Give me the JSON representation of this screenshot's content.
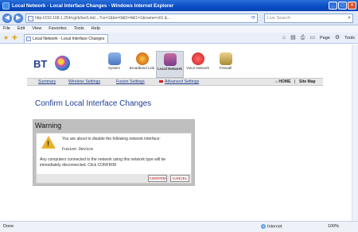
{
  "window": {
    "title": "Local Network - Local Interface Changes - Windows Internet Explorer",
    "controls": [
      "_",
      "□",
      "×"
    ]
  },
  "browser": {
    "address": "http://192.168.1.254/cgi/b/lan/Link/...?ce=1&be=0&l0=4&l1=1&name=ctl1 &...",
    "search_placeholder": "Live Search",
    "menu": [
      "File",
      "Edit",
      "View",
      "Favorites",
      "Tools",
      "Help"
    ],
    "tab_title": "Local Network - Local Interface Changes",
    "commands": {
      "page": "Page",
      "tools": "Tools"
    }
  },
  "page": {
    "logo_text": "BT",
    "nav_icons": [
      {
        "label": "System"
      },
      {
        "label": "Broadband Link"
      },
      {
        "label": "Local Network"
      },
      {
        "label": "Voice Network"
      },
      {
        "label": "Firewall"
      }
    ],
    "tabs": [
      "Summary",
      "Wireless Settings",
      "Fusion Settings",
      "Advanced Settings"
    ],
    "home_label": "HOME",
    "sitemap_label": "Site Map",
    "heading": "Confirm Local Interface Changes",
    "warning": {
      "title": "Warning",
      "message": "You are about to disable the following network interface:",
      "interface": "Fusion Device",
      "consequence": "Any computers connected to the network using this network type will be immediately disconnected. Click CONFIRM",
      "confirm_label": "CONFIRM",
      "cancel_label": "CANCEL"
    }
  },
  "status": {
    "text": "Done",
    "zone": "Internet",
    "zoom": "100%"
  }
}
